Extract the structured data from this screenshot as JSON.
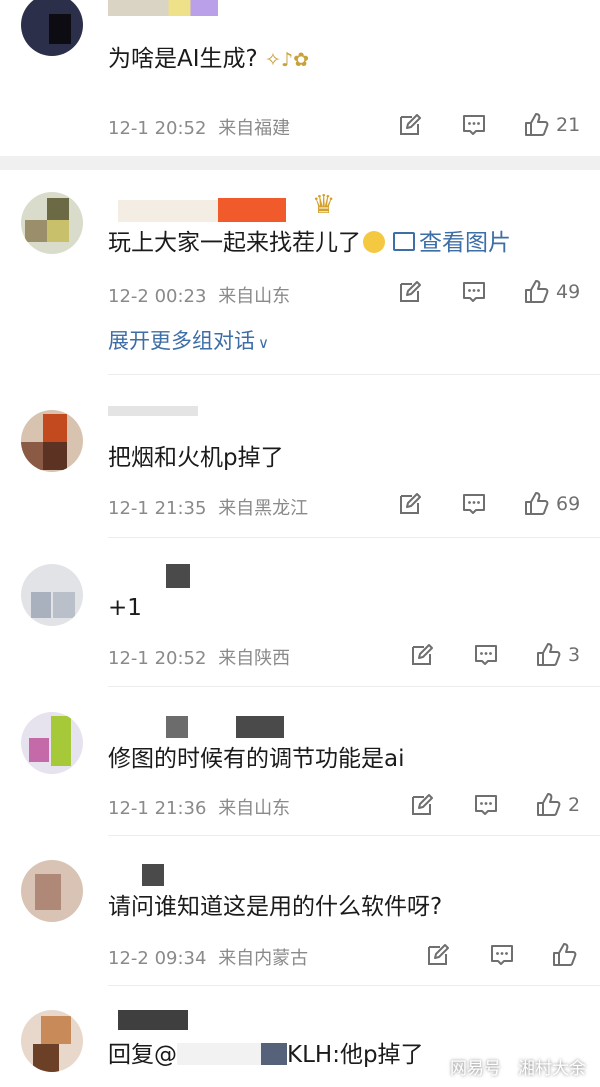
{
  "comments": [
    {
      "text": "为啥是AI生成?",
      "date": "12-1 20:52",
      "location": "来自福建",
      "likes": "21"
    },
    {
      "text": "玩上大家一起来找茬儿了",
      "link": "查看图片",
      "date": "12-2 00:23",
      "location": "来自山东",
      "likes": "49",
      "expand": "展开更多组对话"
    },
    {
      "text": "把烟和火机p掉了",
      "date": "12-1 21:35",
      "location": "来自黑龙江",
      "likes": "69"
    },
    {
      "text": "+1",
      "date": "12-1 20:52",
      "location": "来自陕西",
      "likes": "3"
    },
    {
      "text": "修图的时候有的调节功能是ai",
      "date": "12-1 21:36",
      "location": "来自山东",
      "likes": "2"
    },
    {
      "text": "请问谁知道这是用的什么软件呀?",
      "date": "12-2 09:34",
      "location": "来自内蒙古",
      "likes": ""
    },
    {
      "reply_prefix": "回复@",
      "reply_name_tail": "KLH",
      "reply_text": ":他p掉了"
    }
  ],
  "watermark": {
    "left": "网易号",
    "right": "湘村大余"
  },
  "icons": {
    "edit": "edit-icon",
    "comment": "comment-icon",
    "like": "thumbs-up-icon"
  },
  "colors": {
    "link": "#3d6ea6",
    "meta": "#8a8a8a"
  }
}
